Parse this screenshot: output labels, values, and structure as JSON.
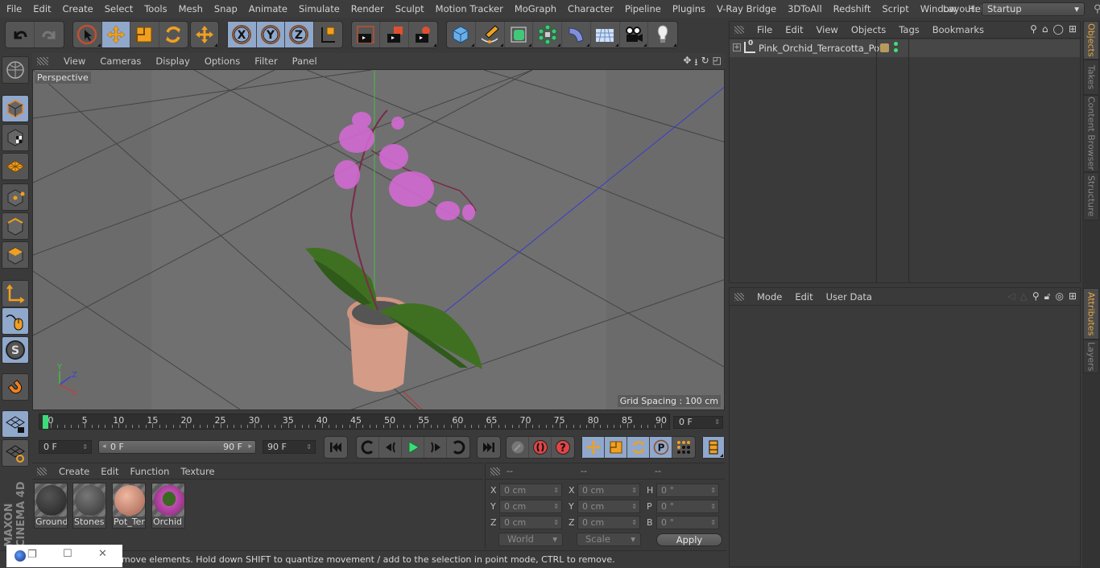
{
  "menubar": {
    "items": [
      "File",
      "Edit",
      "Create",
      "Select",
      "Tools",
      "Mesh",
      "Snap",
      "Animate",
      "Simulate",
      "Render",
      "Sculpt",
      "Motion Tracker",
      "MoGraph",
      "Character",
      "Pipeline",
      "Plugins",
      "V-Ray Bridge",
      "3DToAll",
      "Redshift",
      "Script",
      "Window",
      "Help"
    ],
    "layout_label": "Layout:",
    "layout_value": "Startup"
  },
  "toolbar": {
    "groups": [
      {
        "name": "history",
        "tools": [
          "undo-icon",
          "redo-icon"
        ]
      },
      {
        "name": "modes",
        "tools": [
          "live-selection-icon",
          "move-icon",
          "scale-icon",
          "rotate-icon"
        ]
      },
      {
        "name": "recent",
        "tools": [
          "move-icon"
        ]
      },
      {
        "name": "axis",
        "tools": [
          "x-axis-icon",
          "y-axis-icon",
          "z-axis-icon",
          "coordinate-system-icon"
        ]
      },
      {
        "name": "render",
        "tools": [
          "render-view-icon",
          "render-picture-viewer-icon",
          "render-settings-icon"
        ]
      },
      {
        "name": "objects",
        "tools": [
          "cube-icon",
          "pen-spline-icon",
          "subdivision-icon",
          "cloner-icon",
          "deformer-icon",
          "floor-icon",
          "camera-icon",
          "light-icon"
        ]
      }
    ]
  },
  "left_tools": [
    "make-editable-icon",
    "model-mode-icon",
    "texture-mode-icon",
    "workplane-mode-icon",
    "points-mode-icon",
    "edges-mode-icon",
    "polygons-mode-icon",
    "axis-mode-icon",
    "tweak-mode-icon",
    "solo-icon",
    "snap-icon",
    "workplane-lock-icon",
    "workplane-rotate-icon"
  ],
  "brand": "MAXON CINEMA 4D",
  "viewport": {
    "menu": [
      "View",
      "Cameras",
      "Display",
      "Options",
      "Filter",
      "Panel"
    ],
    "camera_label": "Perspective",
    "grid_spacing": "Grid Spacing : 100 cm",
    "axis_labels": {
      "x": "X",
      "y": "Y",
      "z": "Z"
    },
    "colors": {
      "x_axis": "#d04040",
      "y_axis": "#40c040",
      "z_axis": "#4040d0",
      "flower": "#d86ad8",
      "leaf": "#3a6a22",
      "pot": "#d89a86",
      "soil": "#555555"
    }
  },
  "timeline": {
    "ticks": [
      0,
      5,
      10,
      15,
      20,
      25,
      30,
      35,
      40,
      45,
      50,
      55,
      60,
      65,
      70,
      75,
      80,
      85,
      90
    ],
    "current_frame": "0 F",
    "current_frame_value": 0,
    "end_label": "90 F"
  },
  "transport": {
    "start_field": "0 F",
    "range_start": "0 F",
    "range_end": "90 F",
    "end_field": "90 F",
    "buttons": [
      "go-to-start-icon",
      "previous-key-icon",
      "play-backwards-icon",
      "play-forwards-icon",
      "next-key-icon",
      "loop-icon",
      "go-to-end-icon"
    ],
    "record_buttons": [
      "autokey-icon",
      "record-icon",
      "keyframe-help-icon"
    ],
    "key_buttons": [
      "key-position-icon",
      "key-scale-icon",
      "key-rotation-icon",
      "key-param-icon",
      "key-pla-icon",
      "timeline-icon"
    ]
  },
  "materials": {
    "menu": [
      "Create",
      "Edit",
      "Function",
      "Texture"
    ],
    "items": [
      {
        "name": "Ground",
        "color": "#3a3a3a"
      },
      {
        "name": "Stones",
        "color": "#5a5a5a"
      },
      {
        "name": "Pot_Terr",
        "color": "#d99b82"
      },
      {
        "name": "Orchid",
        "color": "#c050b0"
      }
    ]
  },
  "coordinates": {
    "headers": [
      "--",
      "--",
      "--"
    ],
    "rows": [
      {
        "l1": "X",
        "v1": "0 cm",
        "l2": "X",
        "v2": "0 cm",
        "l3": "H",
        "v3": "0 °"
      },
      {
        "l1": "Y",
        "v1": "0 cm",
        "l2": "Y",
        "v2": "0 cm",
        "l3": "P",
        "v3": "0 °"
      },
      {
        "l1": "Z",
        "v1": "0 cm",
        "l2": "Z",
        "v2": "0 cm",
        "l3": "B",
        "v3": "0 °"
      }
    ],
    "space": "World",
    "mode": "Scale",
    "apply": "Apply"
  },
  "status": "move elements. Hold down SHIFT to quantize movement / add to the selection in point mode, CTRL to remove.",
  "objects_panel": {
    "menu": [
      "File",
      "Edit",
      "View",
      "Objects",
      "Tags",
      "Bookmarks"
    ],
    "objects": [
      {
        "name": "Pink_Orchid_Terracotta_Pot",
        "tag_color": "#b89a5e"
      }
    ]
  },
  "attributes_panel": {
    "menu": [
      "Mode",
      "Edit",
      "User Data"
    ]
  },
  "side_tabs": {
    "top": [
      {
        "label": "Objects",
        "active": true
      },
      {
        "label": "Takes",
        "active": false
      },
      {
        "label": "Content Browser",
        "active": false
      },
      {
        "label": "Structure",
        "active": false
      }
    ],
    "bottom": [
      {
        "label": "Attributes",
        "active": true
      },
      {
        "label": "Layers",
        "active": false
      }
    ]
  }
}
